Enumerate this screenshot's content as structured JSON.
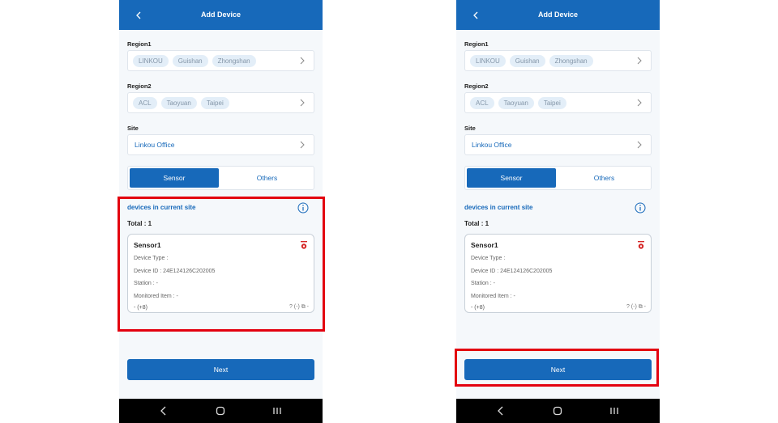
{
  "colors": {
    "primary": "#1769ba",
    "highlight": "#e3000f",
    "chip_bg": "#e3eef8"
  },
  "screens": [
    {
      "header": {
        "title": "Add Device",
        "back_icon": "chevron-left-icon"
      },
      "region1": {
        "label": "Region1",
        "chips": [
          "LINKOU",
          "Guishan",
          "Zhongshan"
        ]
      },
      "region2": {
        "label": "Region2",
        "chips": [
          "ACL",
          "Taoyuan",
          "Taipei"
        ]
      },
      "site": {
        "label": "Site",
        "value": "Linkou Office"
      },
      "tabs": {
        "sensor": "Sensor",
        "others": "Others",
        "active": "Sensor"
      },
      "devices": {
        "title": "devices in current site",
        "total": "Total : 1",
        "items": [
          {
            "name": "Sensor1",
            "device_type": "Device Type :",
            "device_id": "Device ID : 24E124126C202005",
            "station": "Station : -",
            "monitored_item": "Monitored Item : -",
            "footer": "- (+8)",
            "footer_icons": "? (-) ⧉ -"
          }
        ]
      },
      "next_label": "Next",
      "highlighted": "devices-section"
    },
    {
      "header": {
        "title": "Add Device",
        "back_icon": "chevron-left-icon"
      },
      "region1": {
        "label": "Region1",
        "chips": [
          "LINKOU",
          "Guishan",
          "Zhongshan"
        ]
      },
      "region2": {
        "label": "Region2",
        "chips": [
          "ACL",
          "Taoyuan",
          "Taipei"
        ]
      },
      "site": {
        "label": "Site",
        "value": "Linkou Office"
      },
      "tabs": {
        "sensor": "Sensor",
        "others": "Others",
        "active": "Sensor"
      },
      "devices": {
        "title": "devices in current site",
        "total": "Total : 1",
        "items": [
          {
            "name": "Sensor1",
            "device_type": "Device Type :",
            "device_id": "Device ID : 24E124126C202005",
            "station": "Station : -",
            "monitored_item": "Monitored Item : -",
            "footer": "- (+8)",
            "footer_icons": "? (-) ⧉ -"
          }
        ]
      },
      "next_label": "Next",
      "highlighted": "next-button"
    }
  ]
}
